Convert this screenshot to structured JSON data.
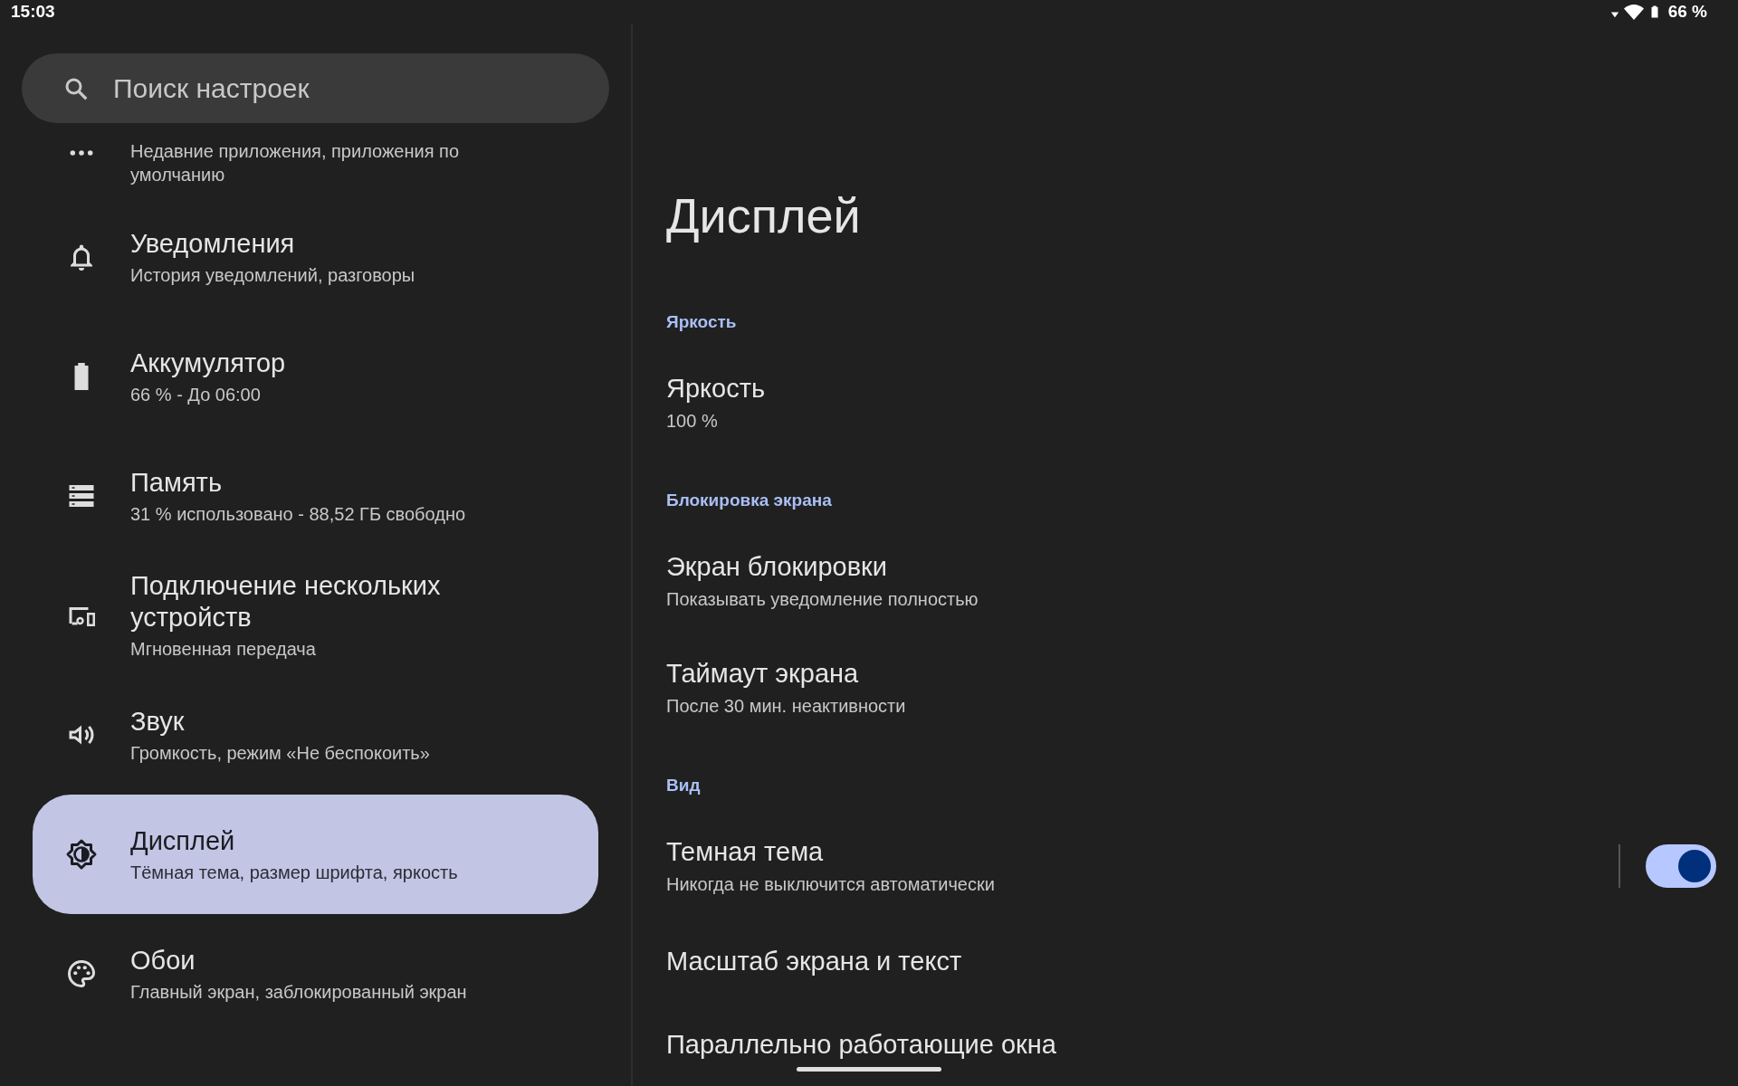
{
  "status_bar": {
    "time": "15:03",
    "battery": "66 %"
  },
  "search": {
    "placeholder": "Поиск настроек"
  },
  "sidebar": {
    "items": [
      {
        "summary": "Недавние приложения, приложения по умолчанию",
        "selected": false
      },
      {
        "title": "Уведомления",
        "summary": "История уведомлений, разговоры",
        "selected": false
      },
      {
        "title": "Аккумулятор",
        "summary": "66 % - До 06:00",
        "selected": false
      },
      {
        "title": "Память",
        "summary": "31 % использовано - 88,52 ГБ свободно",
        "selected": false
      },
      {
        "title": "Подключение нескольких устройств",
        "summary": "Мгновенная передача",
        "selected": false
      },
      {
        "title": "Звук",
        "summary": "Громкость, режим «Не беспокоить»",
        "selected": false
      },
      {
        "title": "Дисплей",
        "summary": "Тёмная тема, размер шрифта, яркость",
        "selected": true
      },
      {
        "title": "Обои",
        "summary": "Главный экран, заблокированный экран",
        "selected": false
      }
    ]
  },
  "page": {
    "title": "Дисплей",
    "sections": [
      {
        "label": "Яркость",
        "items": [
          {
            "kind": "text",
            "title": "Яркость",
            "summary": "100 %"
          }
        ]
      },
      {
        "label": "Блокировка экрана",
        "items": [
          {
            "kind": "text",
            "title": "Экран блокировки",
            "summary": "Показывать уведомление полностью"
          },
          {
            "kind": "text",
            "title": "Таймаут экрана",
            "summary": "После 30 мин. неактивности"
          }
        ]
      },
      {
        "label": "Вид",
        "items": [
          {
            "kind": "toggle",
            "title": "Темная тема",
            "summary": "Никогда не выключится автоматически",
            "on": true
          },
          {
            "kind": "text",
            "title": "Масштаб экрана и текст"
          },
          {
            "kind": "text",
            "title": "Параллельно работающие окна"
          }
        ]
      }
    ]
  }
}
